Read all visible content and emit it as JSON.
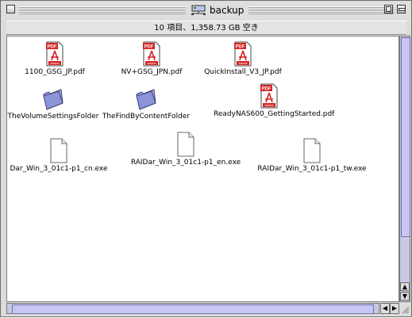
{
  "window": {
    "title": "backup",
    "info": "10 項目、1,358.73 GB 空き"
  },
  "items": [
    {
      "label": "1100_GSG_JP.pdf",
      "icon": "pdf-icon"
    },
    {
      "label": "NV+GSG_JPN.pdf",
      "icon": "pdf-icon"
    },
    {
      "label": "QuickInstall_V3_JP.pdf",
      "icon": "pdf-icon"
    },
    {
      "label": "TheVolumeSettingsFolder",
      "icon": "folder-icon"
    },
    {
      "label": "TheFindByContentFolder",
      "icon": "folder-icon"
    },
    {
      "label": "ReadyNAS600_GettingStarted.pdf",
      "icon": "pdf-icon"
    },
    {
      "label": "Dar_Win_3_01c1-p1_cn.exe",
      "icon": "document-icon"
    },
    {
      "label": "RAIDar_Win_3_01c1-p1_en.exe",
      "icon": "document-icon"
    },
    {
      "label": "RAIDar_Win_3_01c1-p1_tw.exe",
      "icon": "document-icon"
    }
  ],
  "pdf_badge": "PDF",
  "adobe_badge": "Adobe",
  "colors": {
    "scroll": "#c7c7f2",
    "pdf_red": "#d42020",
    "folder": "#8d93d8"
  }
}
